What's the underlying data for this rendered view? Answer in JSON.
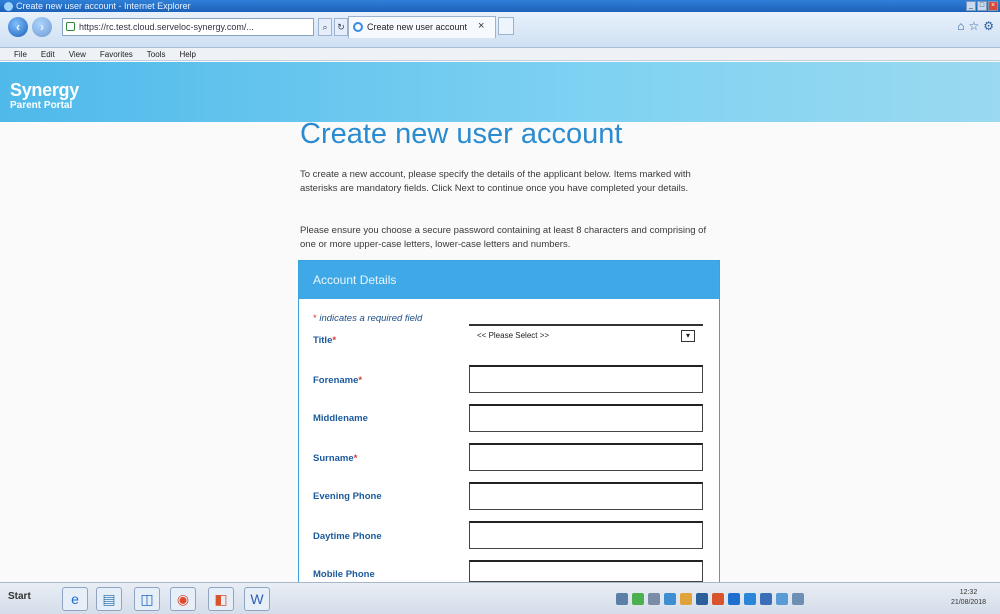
{
  "window": {
    "title": "Create new user account - Internet Explorer",
    "url": "https://rc.test.cloud.serveloc-synergy.com/...",
    "tab_label": "Create new user account",
    "tab_close": "×"
  },
  "menu": [
    "File",
    "Edit",
    "View",
    "Favorites",
    "Tools",
    "Help"
  ],
  "brand": {
    "title": "Synergy",
    "subtitle": "Parent Portal",
    "colors": {
      "banner": "#4fb9ea",
      "heading": "#2a8bd0",
      "panel_header": "#3ea9e6"
    }
  },
  "page": {
    "title": "Create new user account",
    "intro": "To create a new account, please specify the details of the applicant below. Items marked with asterisks are mandatory fields. Click Next to continue once you have completed your details.",
    "password_note": "Please ensure you choose a secure password containing at least 8 characters and comprising of one or more upper-case letters, lower-case letters and numbers."
  },
  "form": {
    "section_title": "Account Details",
    "required_note": "indicates a required field",
    "required_marker": "*",
    "title_label": "Title",
    "title_placeholder": "<< Please Select >>",
    "forename_label": "Forename",
    "middlename_label": "Middlename",
    "surname_label": "Surname",
    "evening_phone_label": "Evening Phone",
    "daytime_phone_label": "Daytime Phone",
    "mobile_phone_label": "Mobile Phone"
  },
  "taskbar": {
    "start_label": "Start",
    "time": "12:32",
    "date": "21/08/2018",
    "apps": [
      "internet-explorer-icon",
      "printer-icon",
      "outlook-icon",
      "chrome-icon",
      "office-icon",
      "word-icon"
    ]
  }
}
